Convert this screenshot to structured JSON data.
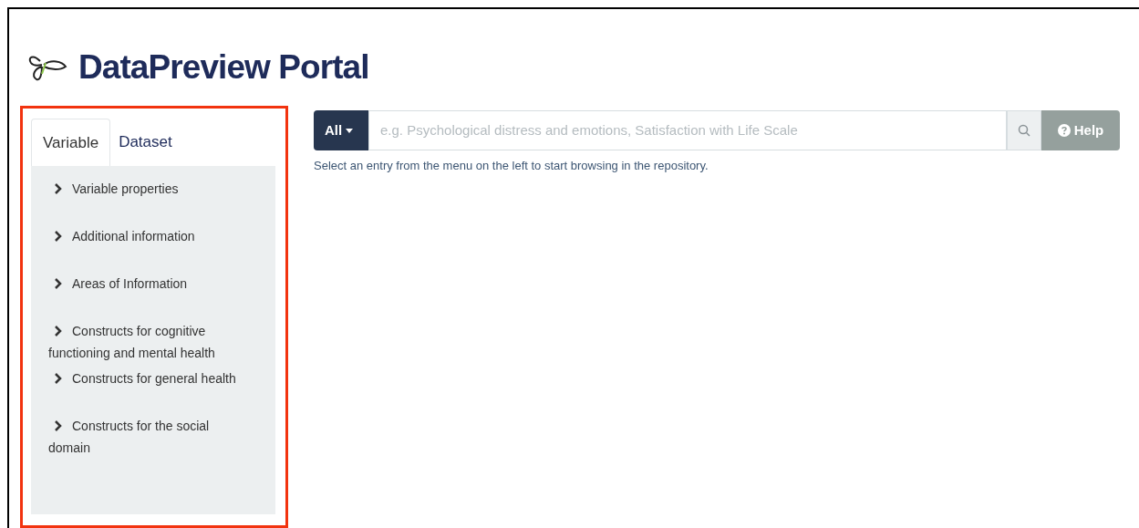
{
  "header": {
    "title": "DataPreview Portal"
  },
  "sidebar": {
    "tabs": [
      {
        "label": "Variable",
        "selected": true
      },
      {
        "label": "Dataset",
        "selected": false
      }
    ],
    "items": [
      {
        "label": "Variable properties",
        "expanded": false
      },
      {
        "label": "Additional information",
        "expanded": false
      },
      {
        "label": "Areas of Information",
        "expanded": false
      },
      {
        "label": "Constructs for cognitive functioning and mental health",
        "expanded": false
      },
      {
        "label": "Constructs for general health",
        "expanded": false
      },
      {
        "label": "Constructs for the social domain",
        "expanded": false
      }
    ]
  },
  "search": {
    "scope": "All",
    "placeholder": "e.g. Psychological distress and emotions, Satisfaction with Life Scale",
    "help": "Help"
  },
  "hint": "Select an entry from the menu on the left to start browsing in the repository."
}
